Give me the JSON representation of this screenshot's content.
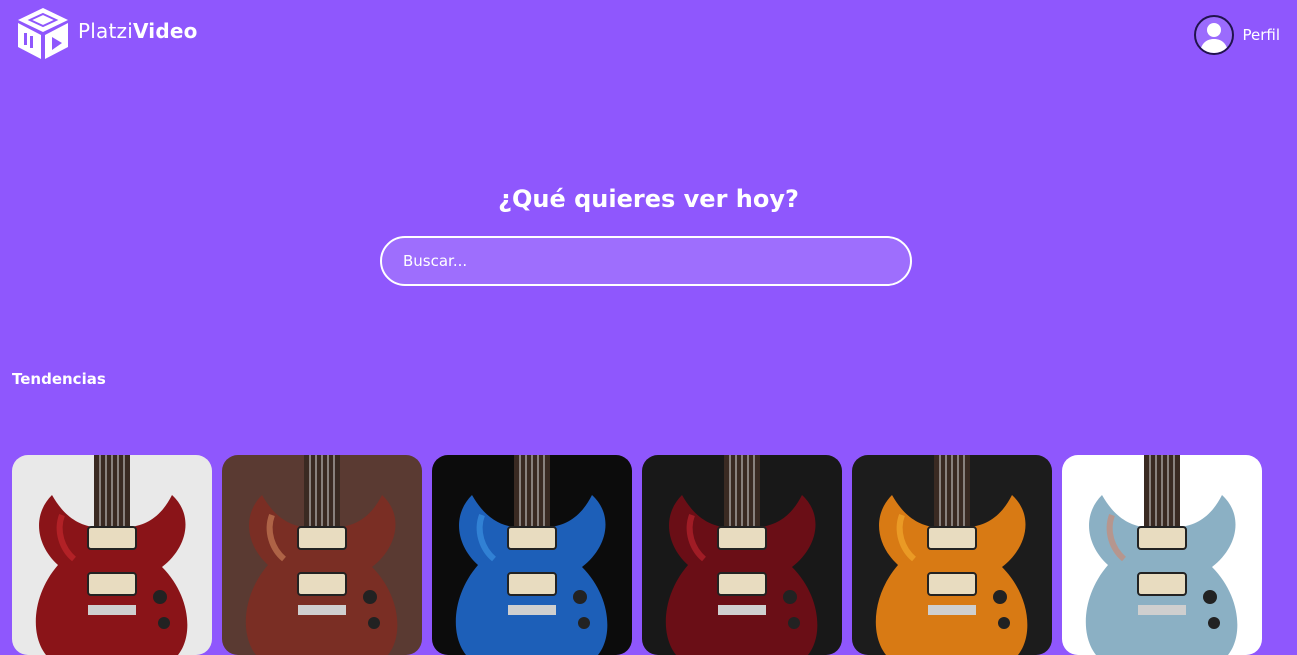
{
  "header": {
    "brand": {
      "light": "Platzi",
      "bold": "Video"
    },
    "profile_label": "Perfil"
  },
  "hero": {
    "title": "¿Qué quieres ver hoy?",
    "search_placeholder": "Buscar..."
  },
  "trends": {
    "title": "Tendencias",
    "items": [
      {
        "bg": "#e9e9e9",
        "body": "#8a1418",
        "accent": "#c3262c"
      },
      {
        "bg": "#5a3a32",
        "body": "#7a2e24",
        "accent": "#c47a55"
      },
      {
        "bg": "#0c0c0c",
        "body": "#1d5fb8",
        "accent": "#3a90e0"
      },
      {
        "bg": "#181818",
        "body": "#6a0e16",
        "accent": "#b8222c"
      },
      {
        "bg": "#1c1c1c",
        "body": "#d87a14",
        "accent": "#f2a82c"
      },
      {
        "bg": "#ffffff",
        "body": "#8bb0c4",
        "accent": "#c98b78"
      }
    ]
  },
  "colors": {
    "background": "#8f57fd",
    "text": "#ffffff",
    "avatar_border": "#21134d"
  }
}
